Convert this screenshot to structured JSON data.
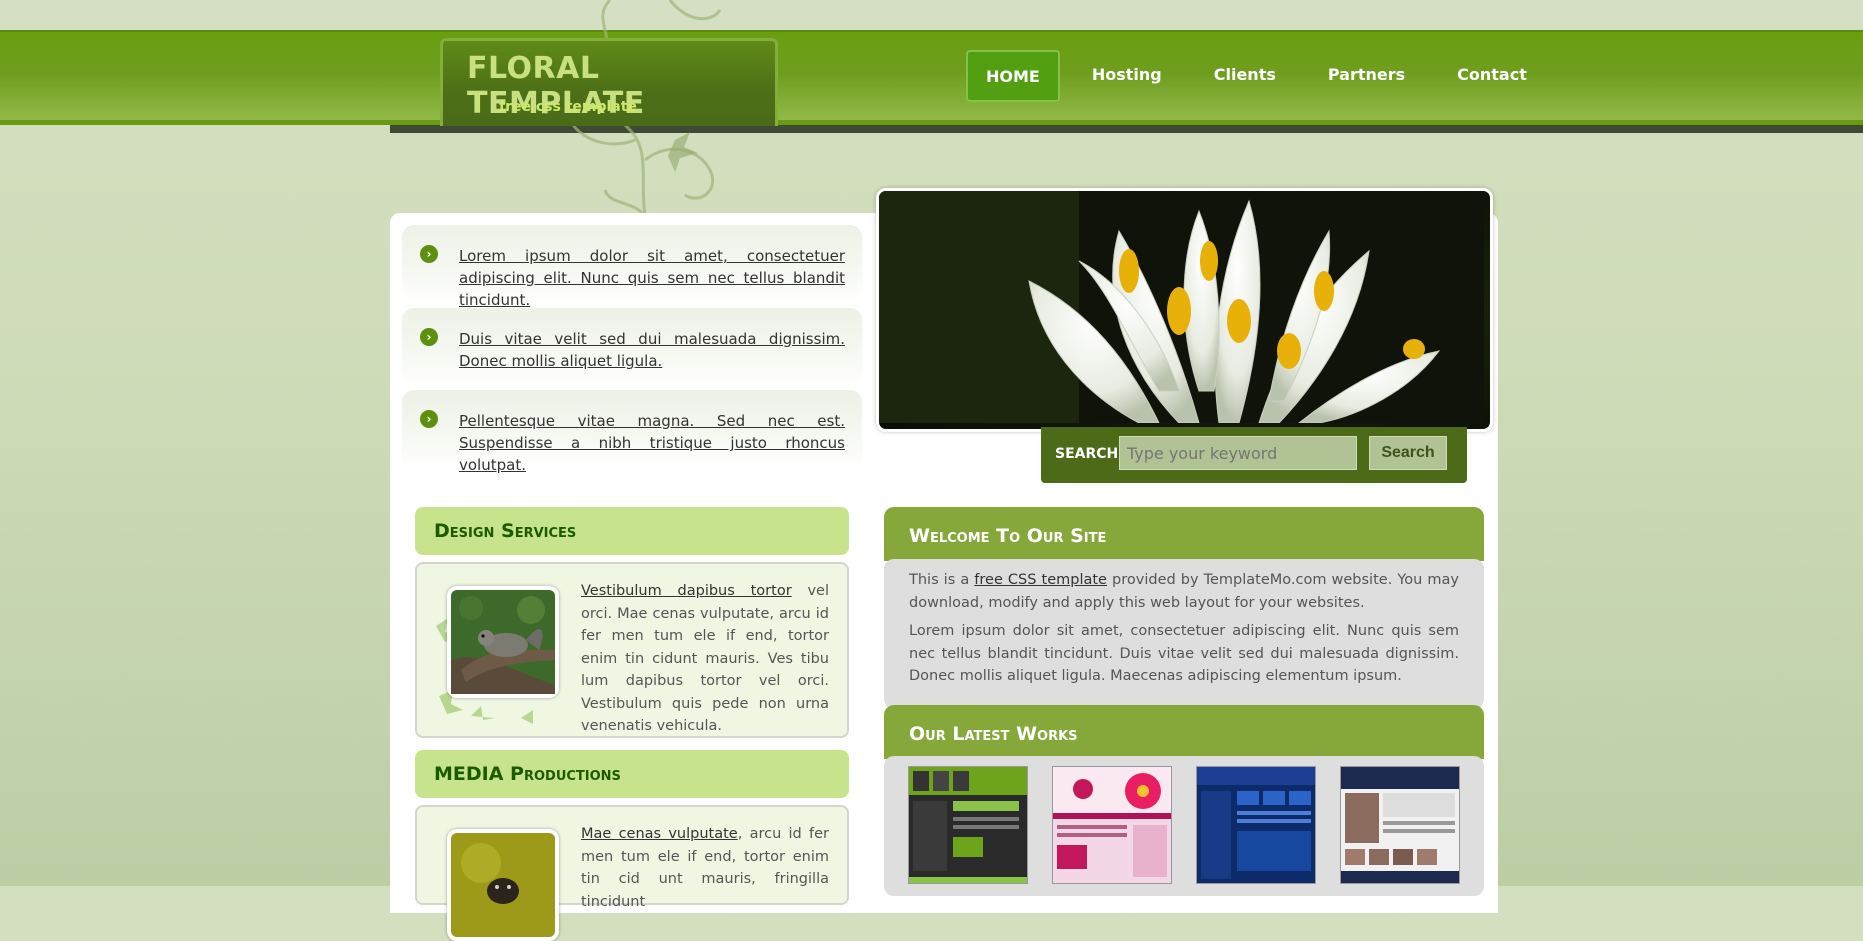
{
  "logo": {
    "title": "FLORAL TEMPLATE",
    "subtitle": "free css template"
  },
  "nav": [
    {
      "label": "HOME",
      "active": true
    },
    {
      "label": "Hosting"
    },
    {
      "label": "Clients"
    },
    {
      "label": "Partners"
    },
    {
      "label": "Contact"
    }
  ],
  "bullets": [
    "Lorem ipsum dolor sit amet, consectetuer adipiscing elit. Nunc quis sem nec tellus blandit tincidunt.",
    "Duis vitae velit sed dui malesuada dignissim. Donec mollis aliquet ligula.",
    "Pellentesque vitae magna. Sed nec est. Suspendisse a nibh tristique justo rhoncus volutpat."
  ],
  "search": {
    "label": "SEARCH:",
    "placeholder": "Type your keyword",
    "button": "Search"
  },
  "design": {
    "title": "Design Services",
    "link": "Vestibulum dapibus tortor",
    "text": " vel orci. Mae cenas vulputate, arcu id fer men tum ele if end, tortor enim tin cidunt mauris. Ves tibu lum dapibus tortor vel orci. Vestibulum quis pede non urna venenatis vehicula."
  },
  "media": {
    "title": "MEDIA Productions",
    "link": "Mae cenas vulputate",
    "text": ", arcu id fer men tum ele if end, tortor enim tin cid unt mauris, fringilla tincidunt"
  },
  "welcome": {
    "title": "Welcome To Our Site",
    "p1_pre": "This is a ",
    "p1_link": "free CSS template",
    "p1_post": " provided by TemplateMo.com website. You may download, modify and apply this web layout for your websites.",
    "p2": "Lorem ipsum dolor sit amet, consectetuer adipiscing elit. Nunc quis sem nec tellus blandit tincidunt. Duis vitae velit sed dui malesuada dignissim. Donec mollis aliquet ligula. Maecenas adipiscing elementum ipsum."
  },
  "works": {
    "title": "Our Latest Works"
  },
  "colors": {
    "header": "#6a9e10",
    "accent": "#c7e38c",
    "panel_green": "#86a83a",
    "search_bg": "#4c6a18"
  }
}
